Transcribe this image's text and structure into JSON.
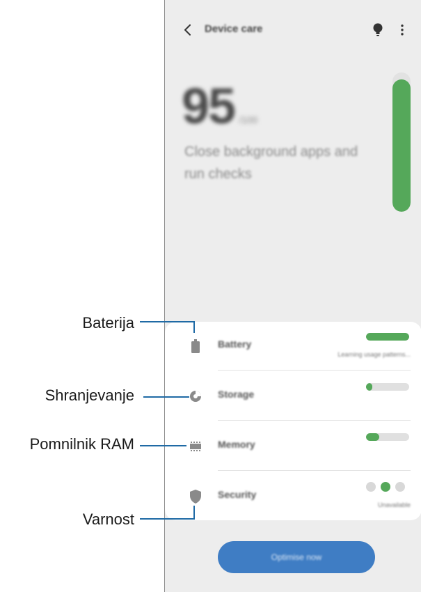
{
  "header": {
    "title": "Device care",
    "back_icon": "chevron-left-icon",
    "tip_icon": "lightbulb-icon",
    "more_icon": "more-vertical-icon"
  },
  "summary": {
    "score": "95",
    "score_max": "/100",
    "hint": "Close background apps and run checks",
    "gauge_level": 0.95
  },
  "items": [
    {
      "key": "battery",
      "label": "Battery",
      "icon": "battery-icon",
      "detail": "Learning usage patterns...",
      "level": 1.0
    },
    {
      "key": "storage",
      "label": "Storage",
      "icon": "pie-chart-icon",
      "detail": "",
      "level": 0.15
    },
    {
      "key": "memory",
      "label": "Memory",
      "icon": "memory-chip-icon",
      "detail": "",
      "level": 0.3
    },
    {
      "key": "security",
      "label": "Security",
      "icon": "shield-icon",
      "detail": "Unavailable",
      "level": null
    }
  ],
  "action": {
    "label": "Optimise now"
  },
  "callouts": [
    {
      "label": "Baterija"
    },
    {
      "label": "Shranjevanje"
    },
    {
      "label": "Pomnilnik RAM"
    },
    {
      "label": "Varnost"
    }
  ],
  "colors": {
    "accent_green": "#55a85a",
    "button_blue": "#3f7dc4",
    "callout_blue": "#1f6aa5",
    "background": "#ededed"
  }
}
